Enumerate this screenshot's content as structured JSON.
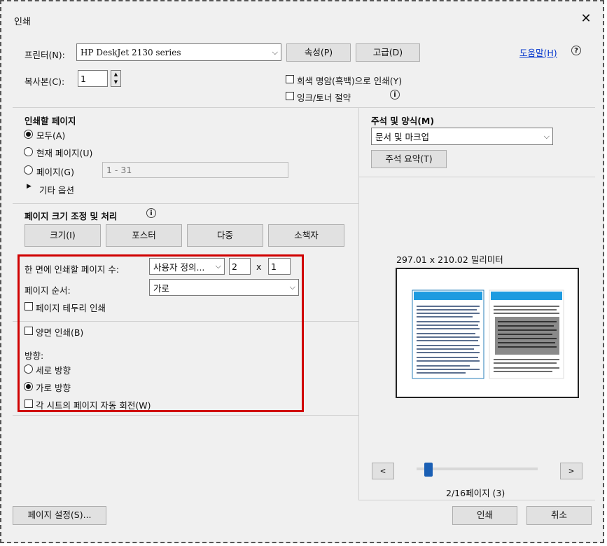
{
  "window": {
    "title": "인쇄",
    "close_glyph": "✕"
  },
  "printer": {
    "label": "프린터(N):",
    "value": "HP DeskJet 2130 series",
    "properties_button": "속성(P)",
    "advanced_button": "고급(D)",
    "help_link": "도움말(H)"
  },
  "copies": {
    "label": "복사본(C):",
    "value": "1"
  },
  "options": {
    "grayscale": "회색 명암(흑백)으로 인쇄(Y)",
    "save_ink": "잉크/토너 절약"
  },
  "pages_to_print": {
    "heading": "인쇄할 페이지",
    "all": "모두(A)",
    "current": "현재 페이지(U)",
    "pages": "페이지(G)",
    "pages_value": "1 - 31",
    "more_options": "기타 옵션",
    "selected": "all"
  },
  "annotations": {
    "heading": "주석 및 양식(M)",
    "value": "문서 및 마크업",
    "summary_button": "주석 요약(T)"
  },
  "page_sizing": {
    "heading": "페이지 크기 조정 및 처리",
    "tabs": [
      "크기(I)",
      "포스터",
      "다중",
      "소책자"
    ]
  },
  "multiple": {
    "pages_per_sheet_label": "한 면에 인쇄할 페이지 수:",
    "pages_per_sheet_value": "사용자 정의...",
    "cols": "2",
    "times": "x",
    "rows": "1",
    "order_label": "페이지 순서:",
    "order_value": "가로",
    "border_label": "페이지 테두리 인쇄"
  },
  "duplex": {
    "label": "양면 인쇄(B)"
  },
  "orientation": {
    "heading": "방향:",
    "portrait": "세로 방향",
    "landscape": "가로 방향",
    "selected": "landscape",
    "auto_rotate": "각 시트의 페이지 자동 회전(W)"
  },
  "preview": {
    "size_text": "297.01 x 210.02 밀리미터",
    "prev": "<",
    "next": ">",
    "page_status": "2/16페이지 (3)",
    "slider_fraction": 0.07
  },
  "footer": {
    "page_setup": "페이지 설정(S)...",
    "print": "인쇄",
    "cancel": "취소"
  },
  "colors": {
    "highlight_box": "#d00000",
    "link": "#0033cc",
    "slider": "#1a5fb4",
    "preview_header": "#1e9be0"
  }
}
